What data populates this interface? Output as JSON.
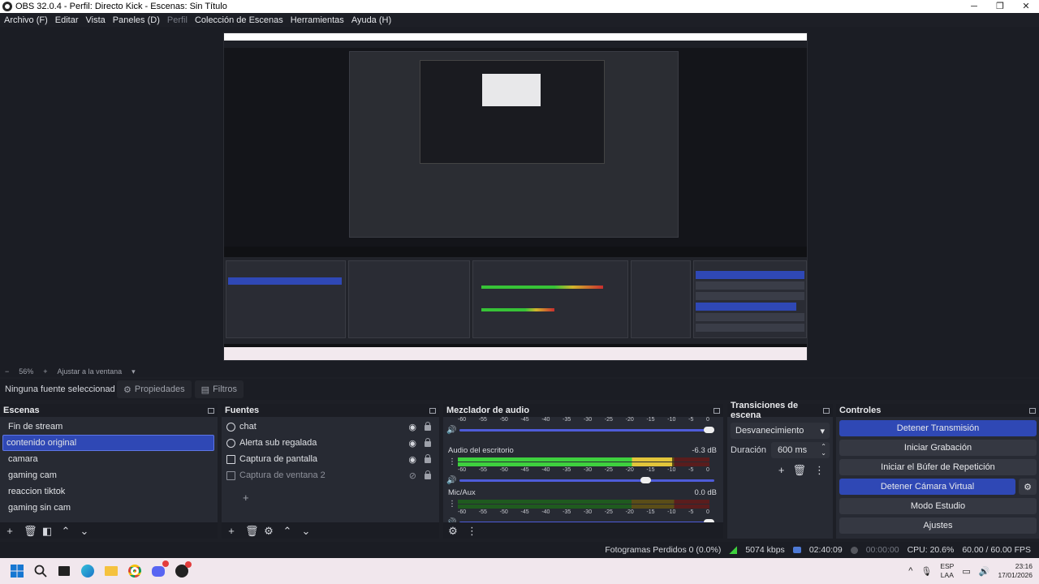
{
  "window": {
    "title": "OBS 32.0.4 - Perfil: Directo Kick - Escenas: Sin Título",
    "minimize": "─",
    "maximize": "❐",
    "close": "✕"
  },
  "menu": [
    "Archivo (F)",
    "Editar",
    "Vista",
    "Paneles (D)",
    "Perfil",
    "Colección de Escenas",
    "Herramientas",
    "Ayuda (H)"
  ],
  "zoom": {
    "minus": "−",
    "level": "56%",
    "plus": "+",
    "fit_label": "Ajustar a la ventana"
  },
  "source_toolbar": {
    "no_source": "Ninguna fuente seleccionad",
    "properties": "Propiedades",
    "filters": "Filtros"
  },
  "scenes": {
    "title": "Escenas",
    "items": [
      "Fin de stream",
      "contenido original",
      "camara",
      "gaming cam",
      "reaccion tiktok",
      "gaming sin cam"
    ],
    "selected_index": 1
  },
  "sources": {
    "title": "Fuentes",
    "items": [
      {
        "name": "chat",
        "icon": "browser-icon",
        "visible": true
      },
      {
        "name": "Alerta sub regalada",
        "icon": "browser-icon",
        "visible": true
      },
      {
        "name": "Captura de pantalla",
        "icon": "monitor-icon",
        "visible": true
      },
      {
        "name": "Captura de ventana 2",
        "icon": "window-icon",
        "visible": false
      }
    ]
  },
  "mixer": {
    "title": "Mezclador de audio",
    "ticks": [
      "-60",
      "-55",
      "-50",
      "-45",
      "-40",
      "-35",
      "-30",
      "-25",
      "-20",
      "-15",
      "-10",
      "-5",
      "0"
    ],
    "channels": [
      {
        "name": "",
        "db": "",
        "level": 0.0,
        "volume": 1.0
      },
      {
        "name": "Audio del escritorio",
        "db": "-6.3 dB",
        "level": 0.85,
        "volume": 0.75
      },
      {
        "name": "Mic/Aux",
        "db": "0.0 dB",
        "level": 0.0,
        "volume": 1.0
      }
    ]
  },
  "transitions": {
    "title": "Transiciones de escena",
    "selected": "Desvanecimiento",
    "duration_label": "Duración",
    "duration_value": "600 ms"
  },
  "controls": {
    "title": "Controles",
    "stop_stream": "Detener Transmisión",
    "start_recording": "Iniciar Grabación",
    "start_replay": "Iniciar el Búfer de Repetición",
    "stop_virtualcam": "Detener Cámara Virtual",
    "studio_mode": "Modo Estudio",
    "settings": "Ajustes"
  },
  "status": {
    "dropped_frames": "Fotogramas Perdidos 0 (0.0%)",
    "bitrate": "5074 kbps",
    "stream_time": "02:40:09",
    "rec_time": "00:00:00",
    "cpu": "CPU: 20.6%",
    "fps": "60.00 / 60.00 FPS"
  },
  "taskbar": {
    "lang_top": "ESP",
    "lang_bottom": "LAA",
    "time": "23:16",
    "date": "17/01/2026",
    "chevron": "^"
  },
  "colors": {
    "accent": "#2f48b5",
    "panel": "#272a33",
    "header": "#1b1d24",
    "meter_green": "#3ed13e",
    "meter_yellow": "#e2c53a",
    "meter_red": "#d93838"
  }
}
